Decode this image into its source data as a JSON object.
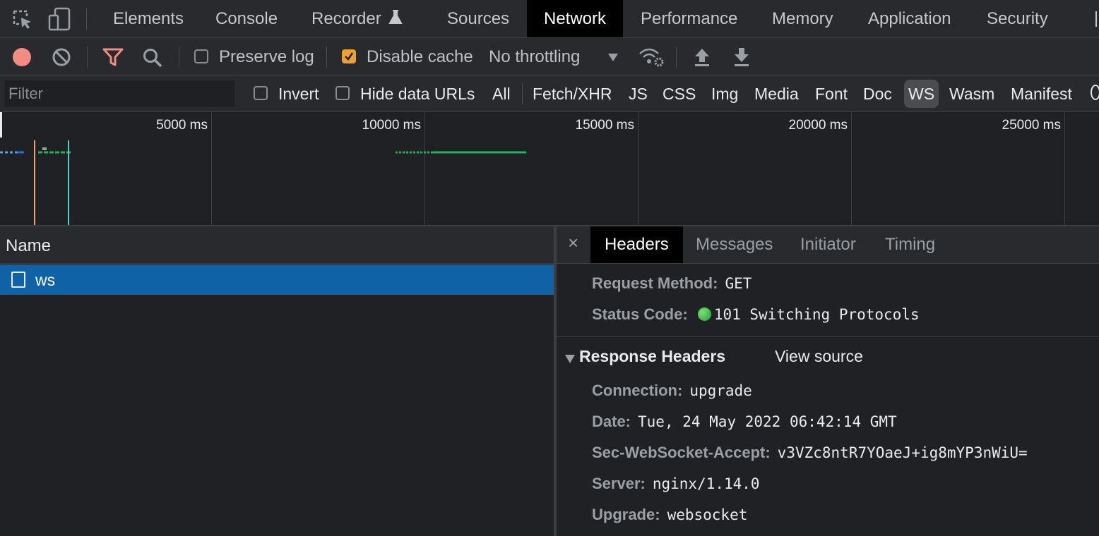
{
  "tabbar": {
    "tabs": [
      "Elements",
      "Console",
      "Recorder",
      "Sources",
      "Network",
      "Performance",
      "Memory",
      "Application",
      "Security"
    ],
    "active_tab": "Network"
  },
  "toolbar": {
    "preserve_log": {
      "label": "Preserve log",
      "checked": false
    },
    "disable_cache": {
      "label": "Disable cache",
      "checked": true
    },
    "throttling": "No throttling"
  },
  "filterbar": {
    "filter_placeholder": "Filter",
    "invert_label": "Invert",
    "hide_data_urls_label": "Hide data URLs",
    "types": [
      "All",
      "Fetch/XHR",
      "JS",
      "CSS",
      "Img",
      "Media",
      "Font",
      "Doc",
      "WS",
      "Wasm",
      "Manifest"
    ],
    "active_type": "WS"
  },
  "overview": {
    "ticks": [
      "5000 ms",
      "10000 ms",
      "15000 ms",
      "20000 ms",
      "25000 ms"
    ]
  },
  "request_list": {
    "column_header": "Name",
    "rows": [
      {
        "name": "ws",
        "selected": true
      }
    ]
  },
  "details": {
    "tabs": [
      "Headers",
      "Messages",
      "Initiator",
      "Timing"
    ],
    "active_tab": "Headers",
    "general": [
      {
        "key": "Request Method:",
        "value": "GET"
      },
      {
        "key": "Status Code:",
        "value": "101 Switching Protocols",
        "status_color": "#2fb34a"
      }
    ],
    "response_headers_title": "Response Headers",
    "view_source": "View source",
    "response_headers": [
      {
        "key": "Connection:",
        "value": "upgrade"
      },
      {
        "key": "Date:",
        "value": "Tue, 24 May 2022 06:42:14 GMT"
      },
      {
        "key": "Sec-WebSocket-Accept:",
        "value": "v3VZc8ntR7YOaeJ+ig8mYP3nWiU="
      },
      {
        "key": "Server:",
        "value": "nginx/1.14.0"
      },
      {
        "key": "Upgrade:",
        "value": "websocket"
      }
    ]
  },
  "colors": {
    "record": "#f28b82",
    "filter_active": "#f28b82",
    "selected_row": "#1062a6",
    "checkbox_checked": "#f0a030"
  }
}
